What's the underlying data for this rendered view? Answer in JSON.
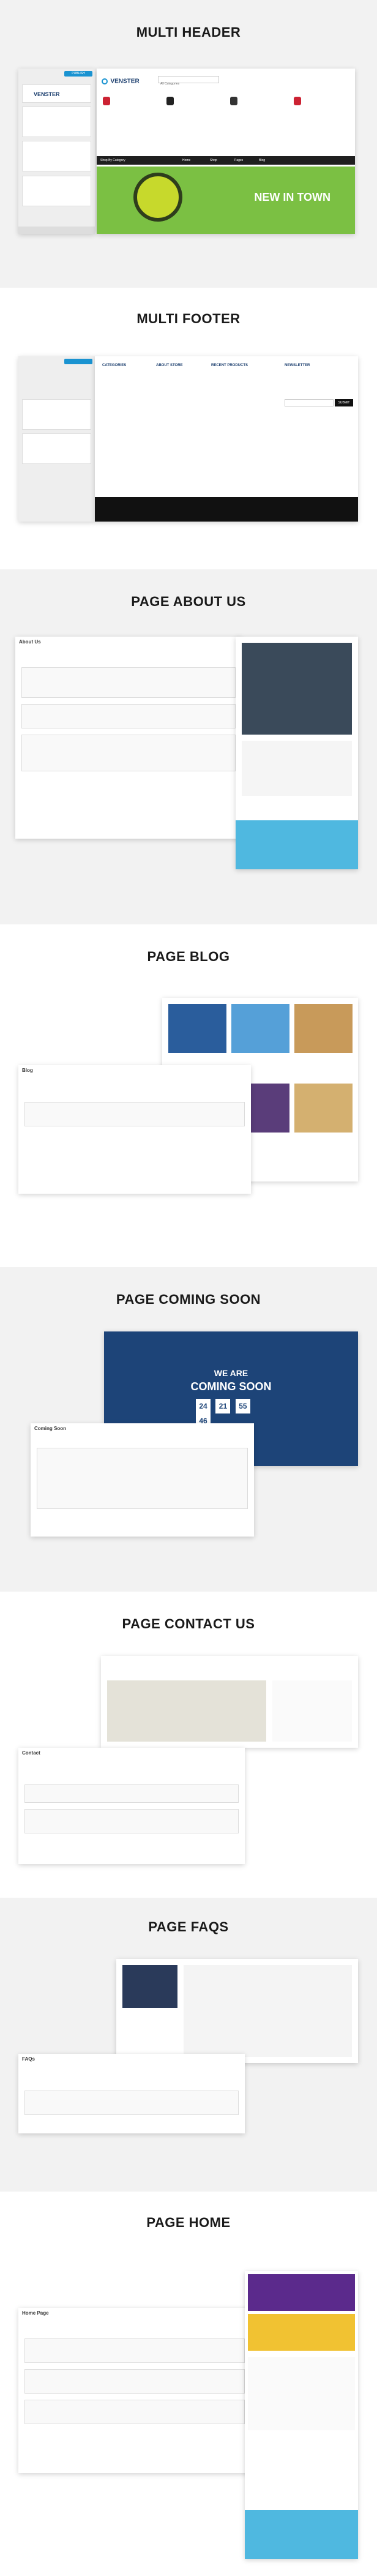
{
  "sections": [
    {
      "title": "MULTI HEADER"
    },
    {
      "title": "MULTI FOOTER"
    },
    {
      "title": "PAGE ABOUT US"
    },
    {
      "title": "PAGE BLOG"
    },
    {
      "title": "PAGE COMING SOON"
    },
    {
      "title": "PAGE CONTACT US"
    },
    {
      "title": "PAGE FAQS"
    },
    {
      "title": "PAGE HOME"
    }
  ],
  "header_demo": {
    "logo": "VENSTER",
    "search_placeholder": "All Categories",
    "banner_title": "NEW IN TOWN",
    "nav": [
      "Shop By Category",
      "Home",
      "Shop",
      "Pages",
      "Blog"
    ],
    "publish_label": "PUBLISH"
  },
  "footer_demo": {
    "cols": [
      "CATEGORIES",
      "ABOUT STORE",
      "RECENT PRODUCTS",
      "NEWSLETTER"
    ],
    "submit": "SUBMIT"
  },
  "about_demo": {
    "admin_title": "About Us"
  },
  "blog_demo": {
    "admin_title": "Blog"
  },
  "coming_demo": {
    "admin_title": "Coming Soon",
    "headline1": "WE ARE",
    "headline2": "COMING SOON",
    "countdown": [
      "24",
      "21",
      "55",
      "46"
    ]
  },
  "contact_demo": {
    "admin_title": "Contact"
  },
  "faqs_demo": {
    "admin_title": "FAQs"
  },
  "home_demo": {
    "admin_title": "Home Page"
  },
  "colors": {
    "accent": "#1a93d1",
    "dark": "#1f1f1f",
    "bg": "#f2f2f2",
    "banner_green": "#7bc043"
  }
}
